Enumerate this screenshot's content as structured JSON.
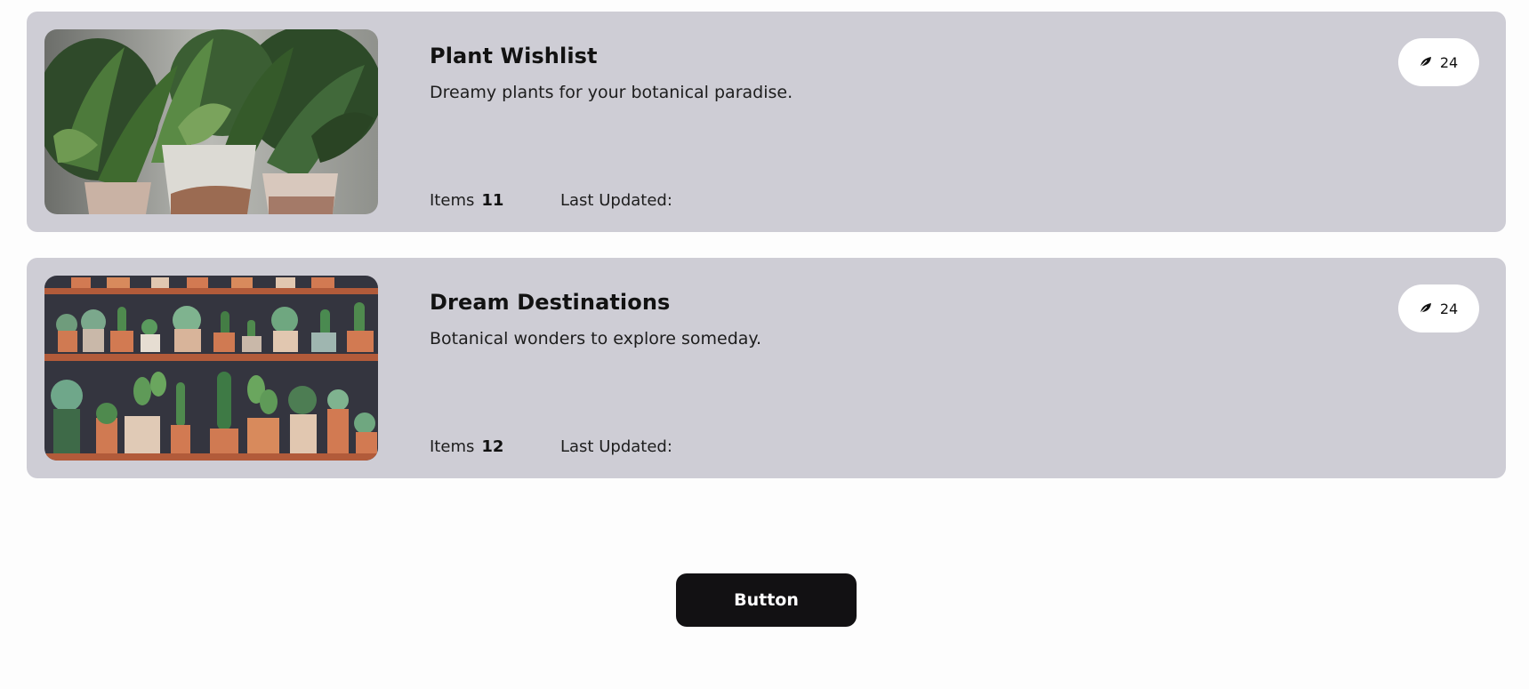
{
  "wishlists": [
    {
      "title": "Plant Wishlist",
      "description": "Dreamy plants for your botanical paradise.",
      "items_label": "Items",
      "items_count": "11",
      "last_updated_label": "Last Updated:",
      "badge_icon": "leaf-icon",
      "badge_count": "24",
      "image": "potted-plants-photo"
    },
    {
      "title": "Dream Destinations",
      "description": "Botanical wonders to explore someday.",
      "items_label": "Items",
      "items_count": "12",
      "last_updated_label": "Last Updated:",
      "badge_icon": "leaf-icon",
      "badge_count": "24",
      "image": "cactus-shelves-photo"
    }
  ],
  "button": {
    "label": "Button"
  },
  "colors": {
    "card_background": "#cecdd5",
    "page_background": "#fdfdfd",
    "button_background": "#121113",
    "badge_background": "#ffffff"
  }
}
